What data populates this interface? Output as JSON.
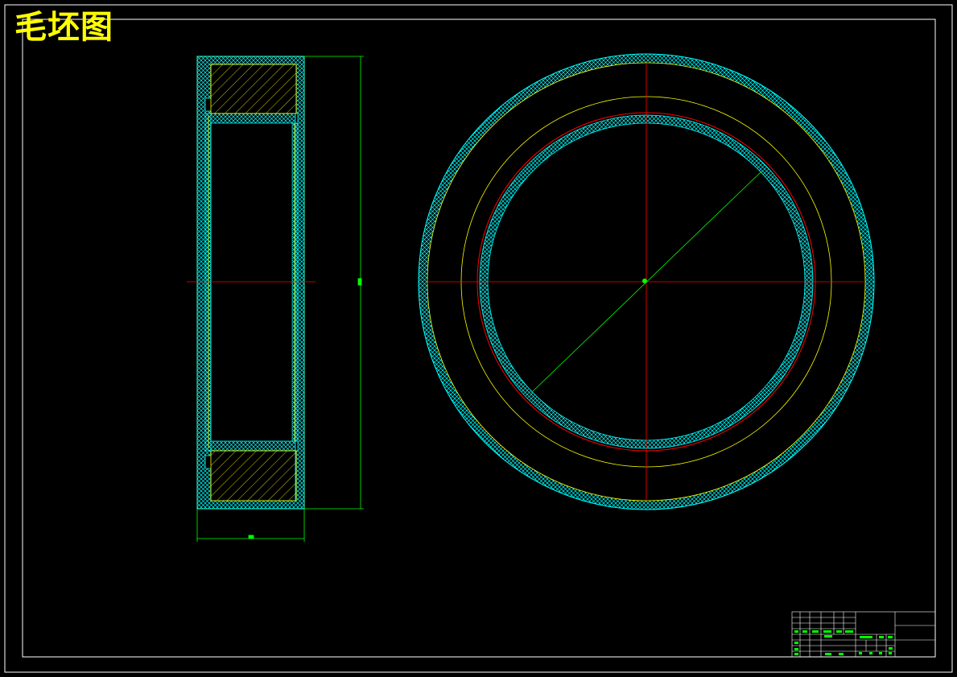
{
  "drawing": {
    "title": "毛坯图"
  },
  "colors": {
    "background": "#000000",
    "frame": "#ffffff",
    "centerline": "#ff0000",
    "dimension": "#00ff00",
    "hatch_crosshatch": "#00ffff",
    "hatch_section": "#ffff00",
    "outline": "#ffff00",
    "title_text": "#ffff00"
  }
}
